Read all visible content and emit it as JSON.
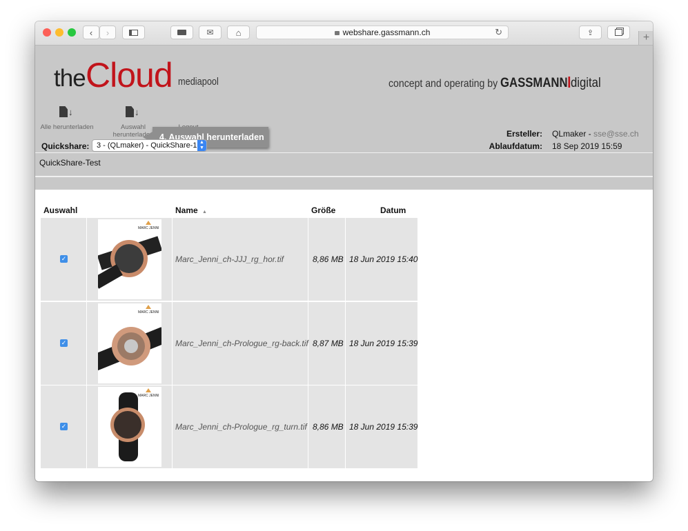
{
  "browser": {
    "url": "webshare.gassmann.ch",
    "new_tab": "+"
  },
  "logo": {
    "the": "the",
    "cloud": "Cloud",
    "suffix": "mediapool",
    "brand_color": "#c1141b"
  },
  "tagline": {
    "prefix": "concept and operating by",
    "brand_bold": "GASSMANN",
    "brand_light": "digital"
  },
  "toolbar": {
    "download_all": "Alle herunterladen",
    "download_selection": "Auswahl herunterladen",
    "logout": "Logout"
  },
  "tooltip": "4. Auswahl herunterladen",
  "meta": {
    "creator_label": "Ersteller:",
    "creator_name": "QLmaker - ",
    "creator_email": "sse@sse.ch",
    "expiry_label": "Ablaufdatum:",
    "expiry_value": "18 Sep 2019 15:59"
  },
  "quickshare": {
    "label": "Quickshare:",
    "selected": "3 - (QLmaker) - QuickShare-1",
    "name": "QuickShare-Test"
  },
  "table": {
    "headers": {
      "select": "Auswahl",
      "name": "Name",
      "size": "Größe",
      "date": "Datum"
    },
    "sort_indicator": "▲",
    "rows": [
      {
        "checked": true,
        "name": "Marc_Jenni_ch-JJJ_rg_hor.tif",
        "size": "8,86 MB",
        "date": "18 Jun 2019 15:40",
        "thumb_brand": "MARC JENNI"
      },
      {
        "checked": true,
        "name": "Marc_Jenni_ch-Prologue_rg-back.tif",
        "size": "8,87 MB",
        "date": "18 Jun 2019 15:39",
        "thumb_brand": "MARC JENNI"
      },
      {
        "checked": true,
        "name": "Marc_Jenni_ch-Prologue_rg_turn.tif",
        "size": "8,86 MB",
        "date": "18 Jun 2019 15:39",
        "thumb_brand": "MARC JENNI"
      }
    ]
  }
}
